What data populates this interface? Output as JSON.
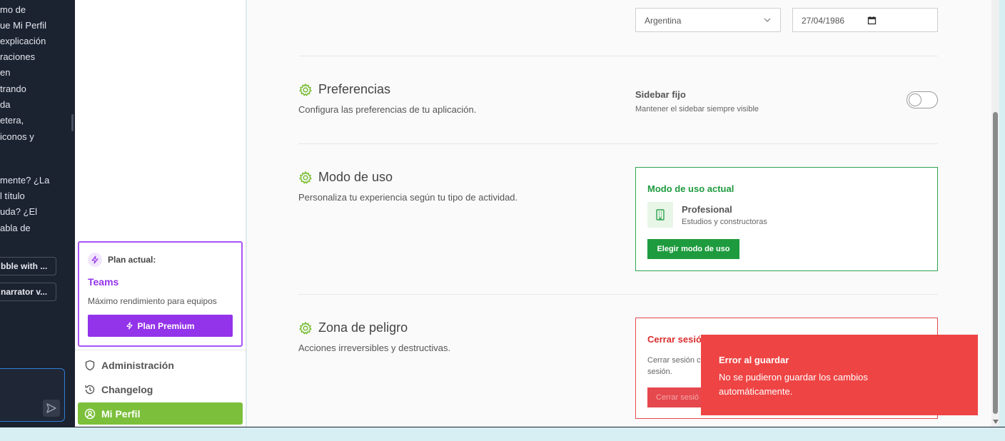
{
  "chat": {
    "lines": [
      "mo de",
      "ue Mi Perfil",
      "explicación",
      "raciones",
      "en",
      "trando",
      "da",
      "etera,",
      "iconos y",
      "mente? ¿La",
      "l título",
      "uda? ¿El",
      "abla de"
    ],
    "suggestions": [
      "bble with ...",
      "narrator v..."
    ]
  },
  "sidebar": {
    "plan": {
      "label": "Plan actual:",
      "name": "Teams",
      "description": "Máximo rendimiento para equipos",
      "button": "Plan Premium"
    },
    "nav": {
      "admin": "Administración",
      "changelog": "Changelog",
      "profile": "Mi Perfil"
    }
  },
  "profile": {
    "country": "Argentina",
    "birthdate": "27/04/1986"
  },
  "preferences": {
    "title": "Preferencias",
    "description": "Configura las preferencias de tu aplicación.",
    "sidebar_label": "Sidebar fijo",
    "sidebar_sub": "Mantener el sidebar siempre visible",
    "sidebar_fixed": false
  },
  "usage_mode": {
    "title": "Modo de uso",
    "description": "Personaliza tu experiencia según tu tipo de actividad.",
    "card_title": "Modo de uso actual",
    "mode_name": "Profesional",
    "mode_sub": "Estudios y constructoras",
    "button": "Elegir modo de uso"
  },
  "danger": {
    "title": "Zona de peligro",
    "description": "Acciones irreversibles y destructivas.",
    "card_title": "Cerrar sesió",
    "card_text_1": "Cerrar sesión c",
    "card_text_2": "sesión.",
    "button": "Cerrar sesió"
  },
  "toast": {
    "title": "Error al guardar",
    "message": "No se pudieron guardar los cambios automáticamente."
  },
  "colors": {
    "accent_green": "#7bbf3a",
    "plan_purple": "#9333ea",
    "mode_green": "#1e9b3e",
    "danger_red": "#e5484d",
    "toast_red": "#ef4444"
  }
}
